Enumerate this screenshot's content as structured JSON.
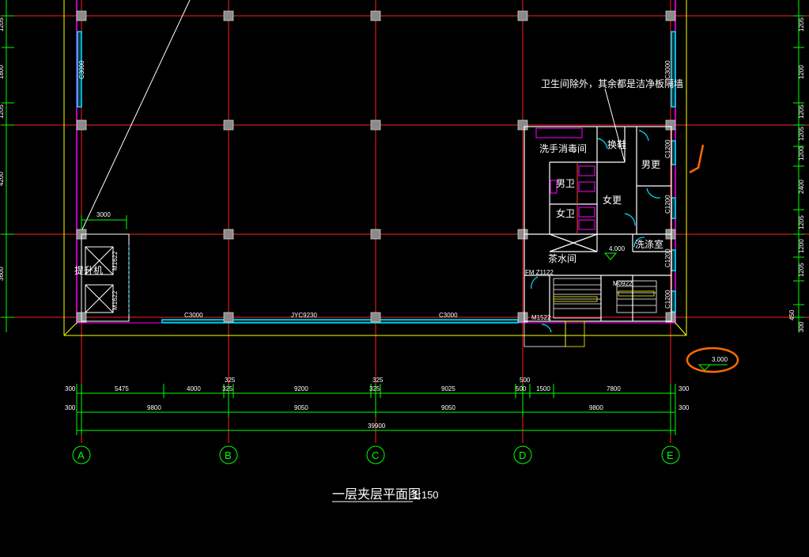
{
  "drawing": {
    "title": "一层夹层平面图",
    "scale": "1:150"
  },
  "axes": [
    "A",
    "B",
    "C",
    "D",
    "E"
  ],
  "dimensions": {
    "row1": [
      "300",
      "5475",
      "4000",
      "325",
      "9200",
      "325",
      "9025",
      "500",
      "1500",
      "7800",
      "300"
    ],
    "row1_top": [
      "325",
      "325",
      "500"
    ],
    "row2": [
      "300",
      "9800",
      "9050",
      "9050",
      "9800",
      "300"
    ],
    "total": "39900",
    "left_column": [
      "3000"
    ],
    "right_column": [
      "1205",
      "1200",
      "1205",
      "1205",
      "1200",
      "2400",
      "1205",
      "1200",
      "1205",
      "450",
      "300"
    ],
    "left_side_column": [
      "1205",
      "1800",
      "1205",
      "1800",
      "4200",
      "3600",
      "300"
    ]
  },
  "rooms": {
    "note": "卫生间除外，其余都是洁净板隔墙",
    "handwash": "洗手消毒间",
    "shoe_change": "换鞋",
    "male_change": "男更",
    "female_change": "女更",
    "male_wc": "男卫",
    "female_wc": "女卫",
    "tea_room": "茶水间",
    "cleaning_room": "洗涤室",
    "elevator": "提升机",
    "level_inner": "4.000",
    "level_outer": "3.000"
  },
  "door_tags": {
    "m1": "M1622",
    "m2": "M1622",
    "m3": "M0922",
    "m4": "M1522",
    "fm": "FM Z1122"
  },
  "window_tags": {
    "w1": "C3000",
    "w2": "C3000",
    "w3": "JYC9230",
    "w4": "C3000",
    "w5": "C3000",
    "w6": "C1200",
    "w7": "C1200",
    "w8": "C1200",
    "w9": "C1200",
    "w10": "C1200"
  },
  "colors": {
    "grid": "#ff2020",
    "wall": "#ff00ff",
    "window": "#00e5ff",
    "dim": "#00ff00",
    "outline": "#ffff00",
    "markup": "#ff6a00"
  }
}
